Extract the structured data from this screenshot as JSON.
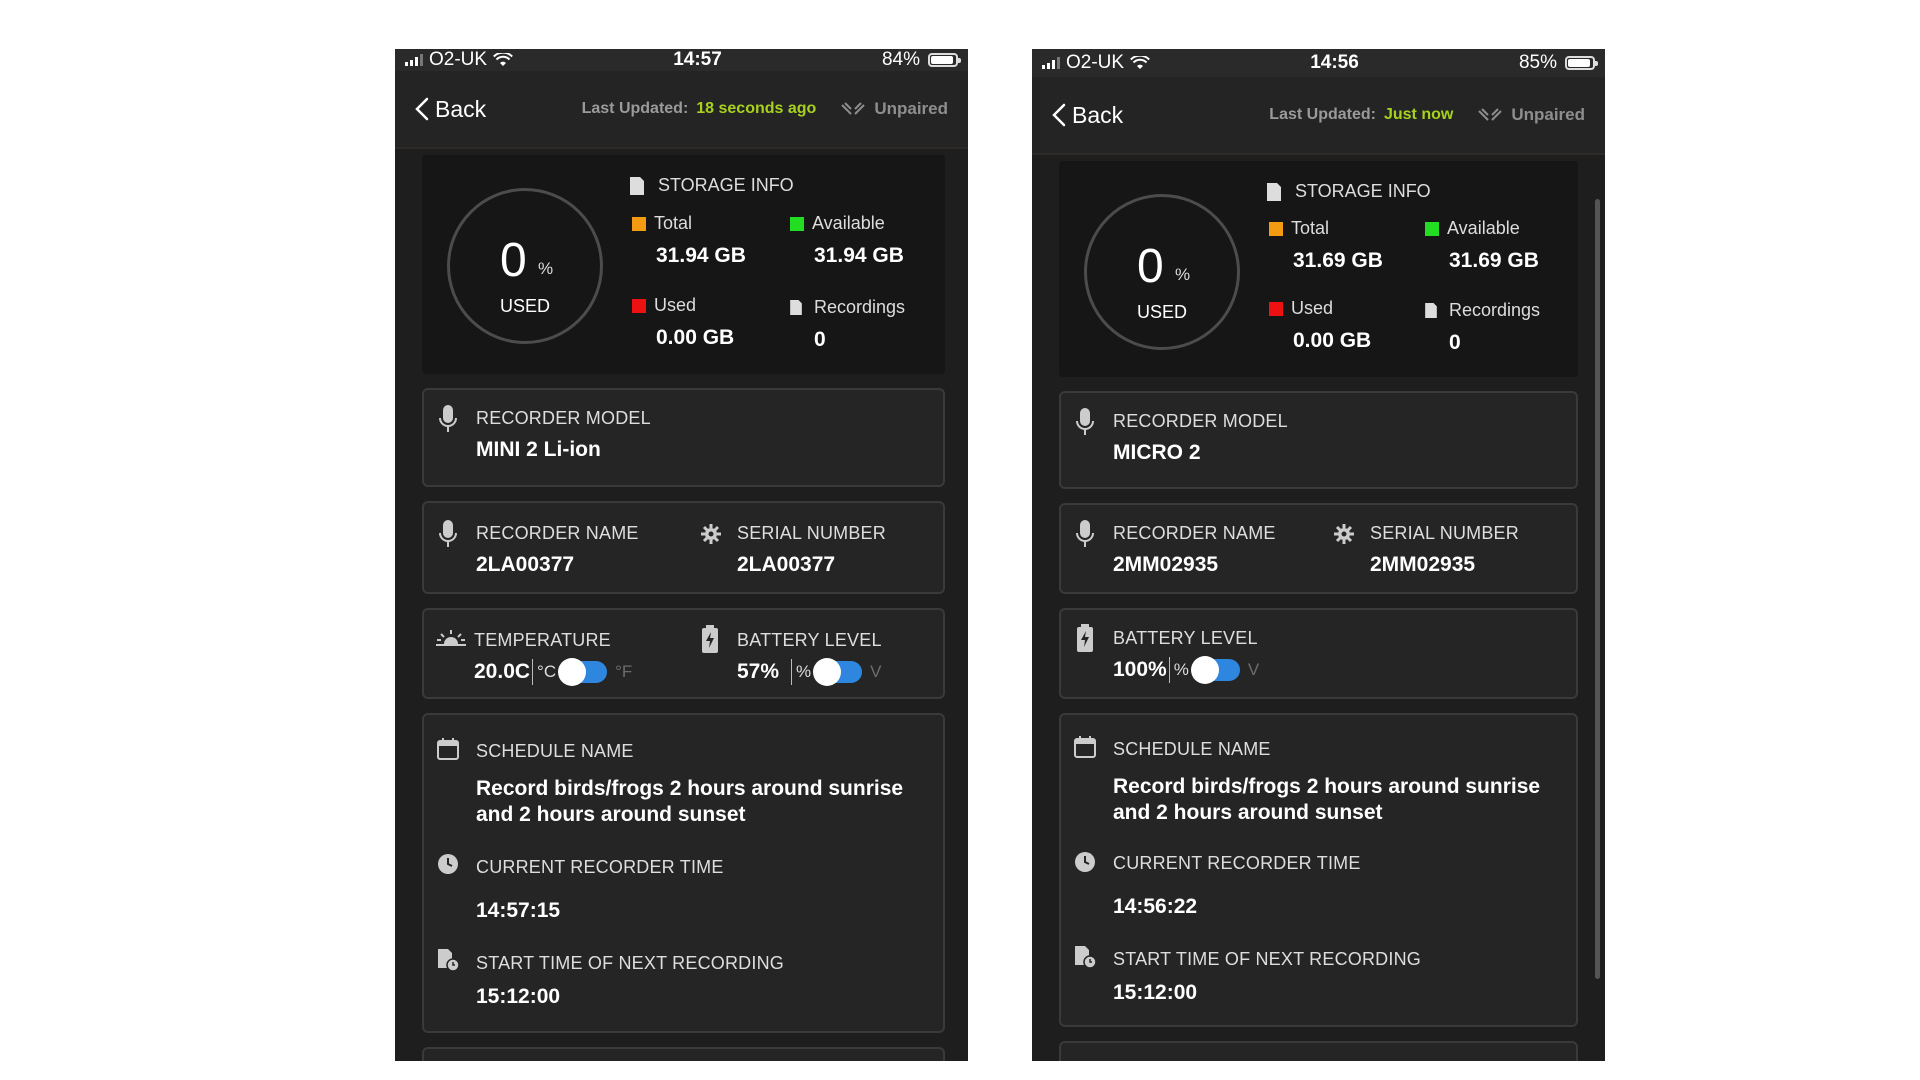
{
  "left": {
    "status": {
      "carrier": "O2-UK",
      "time": "14:57",
      "battery_pct": "84%"
    },
    "nav": {
      "back_label": "Back",
      "last_updated_label": "Last Updated:",
      "last_updated_value": "18 seconds ago",
      "pair_status": "Unpaired"
    },
    "storage": {
      "title": "STORAGE INFO",
      "used_percent": "0",
      "percent_symbol": "%",
      "used_label": "USED",
      "total_label": "Total",
      "total_value": "31.94 GB",
      "available_label": "Available",
      "available_value": "31.94 GB",
      "used_space_label": "Used",
      "used_space_value": "0.00 GB",
      "recordings_label": "Recordings",
      "recordings_value": "0"
    },
    "model": {
      "label": "RECORDER MODEL",
      "value": "MINI 2 Li-ion"
    },
    "name": {
      "label": "RECORDER NAME",
      "value": "2LA00377"
    },
    "serial": {
      "label": "SERIAL NUMBER",
      "value": "2LA00377"
    },
    "temperature": {
      "label": "TEMPERATURE",
      "value": "20.0C",
      "unit_on": "°C",
      "unit_off": "°F"
    },
    "battery": {
      "label": "BATTERY LEVEL",
      "value": "57%",
      "unit_on": "%",
      "unit_off": "V"
    },
    "schedule": {
      "label": "SCHEDULE NAME",
      "value": "Record birds/frogs 2 hours around sunrise and 2 hours around sunset"
    },
    "current_time": {
      "label": "CURRENT RECORDER TIME",
      "value": "14:57:15"
    },
    "next_recording": {
      "label": "START TIME OF NEXT RECORDING",
      "value": "15:12:00"
    }
  },
  "right": {
    "status": {
      "carrier": "O2-UK",
      "time": "14:56",
      "battery_pct": "85%"
    },
    "nav": {
      "back_label": "Back",
      "last_updated_label": "Last Updated:",
      "last_updated_value": "Just now",
      "pair_status": "Unpaired"
    },
    "storage": {
      "title": "STORAGE INFO",
      "used_percent": "0",
      "percent_symbol": "%",
      "used_label": "USED",
      "total_label": "Total",
      "total_value": "31.69 GB",
      "available_label": "Available",
      "available_value": "31.69 GB",
      "used_space_label": "Used",
      "used_space_value": "0.00 GB",
      "recordings_label": "Recordings",
      "recordings_value": "0"
    },
    "model": {
      "label": "RECORDER MODEL",
      "value": "MICRO 2"
    },
    "name": {
      "label": "RECORDER NAME",
      "value": "2MM02935"
    },
    "serial": {
      "label": "SERIAL NUMBER",
      "value": "2MM02935"
    },
    "battery": {
      "label": "BATTERY LEVEL",
      "value": "100%",
      "unit_on": "%",
      "unit_off": "V"
    },
    "schedule": {
      "label": "SCHEDULE NAME",
      "value": "Record birds/frogs 2 hours around sunrise and 2 hours around sunset"
    },
    "current_time": {
      "label": "CURRENT RECORDER TIME",
      "value": "14:56:22"
    },
    "next_recording": {
      "label": "START TIME OF NEXT RECORDING",
      "value": "15:12:00"
    }
  },
  "colors": {
    "total": "#f39c12",
    "available": "#22dd22",
    "used": "#ee1111",
    "accent_green": "#a6d21f",
    "toggle_blue": "#2e86de"
  },
  "icons": [
    "signal-icon",
    "wifi-icon",
    "battery-icon",
    "back-chevron-icon",
    "unpaired-icon",
    "sd-card-icon",
    "microphone-icon",
    "gear-icon",
    "sun-icon",
    "battery-level-icon",
    "calendar-icon",
    "clock-icon",
    "file-clock-icon"
  ]
}
